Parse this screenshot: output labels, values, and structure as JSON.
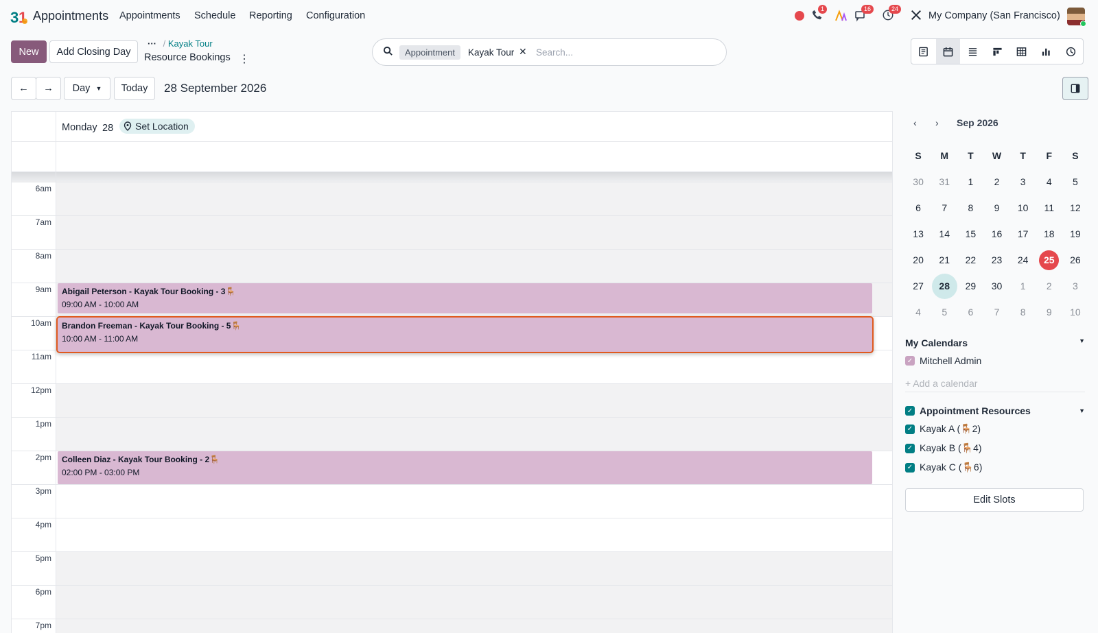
{
  "app": {
    "logo_text": "31",
    "title": "Appointments"
  },
  "menu": [
    "Appointments",
    "Schedule",
    "Reporting",
    "Configuration"
  ],
  "systray": {
    "phone_badge": "1",
    "messages_badge": "16",
    "activity_badge": "24",
    "company": "My Company (San Francisco)"
  },
  "toolbar": {
    "new_label": "New",
    "closing_day_label": "Add Closing Day",
    "breadcrumb_dots": "···",
    "breadcrumb_sep": "/",
    "breadcrumb_parent": "Kayak Tour",
    "breadcrumb_current": "Resource Bookings",
    "kebab": "⋮"
  },
  "search": {
    "facet_label": "Appointment",
    "facet_value": "Kayak Tour",
    "facet_remove": "✕",
    "placeholder": "Search..."
  },
  "nav": {
    "prev": "←",
    "next": "→",
    "scale_label": "Day",
    "today_label": "Today",
    "date_title": "28 September 2026"
  },
  "calendar": {
    "day_name": "Monday",
    "day_number": "28",
    "set_location": "Set Location",
    "hours": [
      "6am",
      "7am",
      "8am",
      "9am",
      "10am",
      "11am",
      "12pm",
      "1pm",
      "2pm",
      "3pm",
      "4pm",
      "5pm",
      "6pm",
      "7pm"
    ],
    "events": [
      {
        "title": "Abigail Peterson - Kayak Tour Booking - 3",
        "time": "09:00 AM - 10:00 AM",
        "chair": "🪑",
        "selected": false
      },
      {
        "title": "Brandon Freeman - Kayak Tour Booking - 5",
        "time": "10:00 AM - 11:00 AM",
        "chair": "🪑",
        "selected": true
      },
      {
        "title": "Colleen Diaz - Kayak Tour Booking - 2",
        "time": "02:00 PM - 03:00 PM",
        "chair": "🪑",
        "selected": false
      }
    ]
  },
  "mini_calendar": {
    "prev": "‹",
    "next": "›",
    "month": "Sep 2026",
    "weekdays": [
      "S",
      "M",
      "T",
      "W",
      "T",
      "F",
      "S"
    ],
    "weeks": [
      [
        "30",
        "31",
        "1",
        "2",
        "3",
        "4",
        "5"
      ],
      [
        "6",
        "7",
        "8",
        "9",
        "10",
        "11",
        "12"
      ],
      [
        "13",
        "14",
        "15",
        "16",
        "17",
        "18",
        "19"
      ],
      [
        "20",
        "21",
        "22",
        "23",
        "24",
        "25",
        "26"
      ],
      [
        "27",
        "28",
        "29",
        "30",
        "1",
        "2",
        "3"
      ],
      [
        "4",
        "5",
        "6",
        "7",
        "8",
        "9",
        "10"
      ]
    ],
    "today": "25",
    "selected": "28"
  },
  "my_calendars": {
    "title": "My Calendars",
    "items": [
      "Mitchell Admin"
    ],
    "add_label": "+ Add a calendar"
  },
  "resources": {
    "title": "Appointment Resources",
    "items": [
      {
        "prefix": "Kayak A (",
        "chair": "🪑",
        "suffix": "2)"
      },
      {
        "prefix": "Kayak B (",
        "chair": "🪑",
        "suffix": "4)"
      },
      {
        "prefix": "Kayak C (",
        "chair": "🪑",
        "suffix": "6)"
      }
    ]
  },
  "edit_slots_label": "Edit Slots",
  "colors": {
    "brand": "#875a7b",
    "event_bg": "#d9b8d2",
    "selected_border": "#e05a1f",
    "today_red": "#e5484d",
    "teal": "#017e84"
  }
}
